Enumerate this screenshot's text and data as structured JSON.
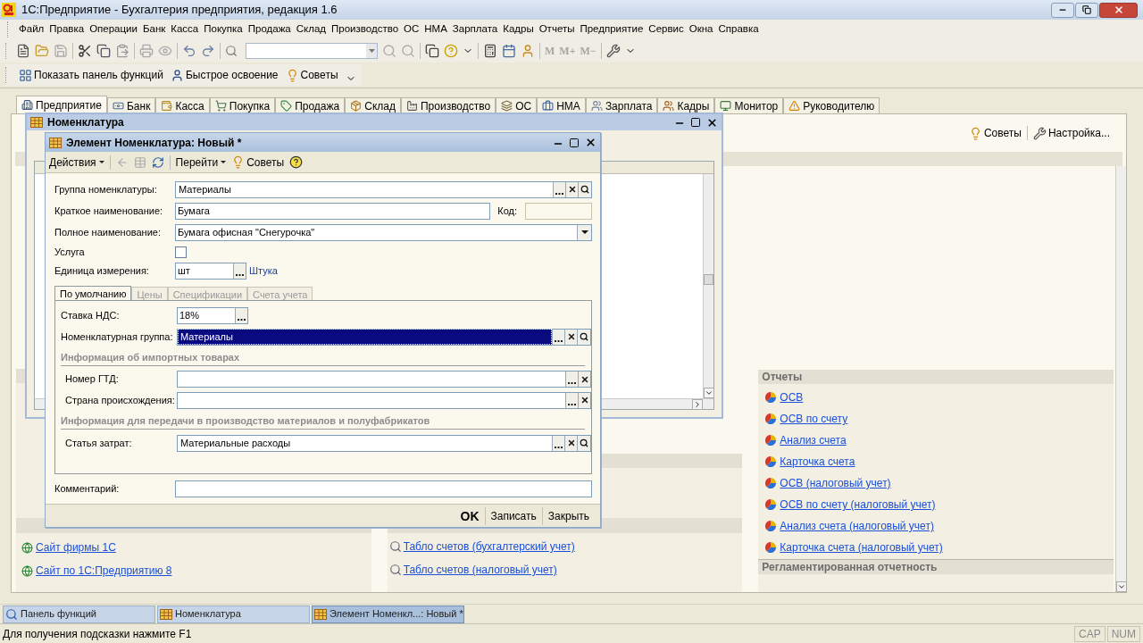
{
  "window": {
    "title": "1С:Предприятие - Бухгалтерия предприятия, редакция 1.6"
  },
  "menu": [
    "Файл",
    "Правка",
    "Операции",
    "Банк",
    "Касса",
    "Покупка",
    "Продажа",
    "Склад",
    "Производство",
    "ОС",
    "НМА",
    "Зарплата",
    "Кадры",
    "Отчеты",
    "Предприятие",
    "Сервис",
    "Окна",
    "Справка"
  ],
  "memory_buttons": [
    "M",
    "M+",
    "M−"
  ],
  "quick_toolbar": [
    "Показать панель функций",
    "Быстрое освоение",
    "Советы"
  ],
  "function_panel": {
    "tabs": [
      {
        "label": "Предприятие",
        "selected": true
      },
      {
        "label": "Банк",
        "selected": false
      },
      {
        "label": "Касса",
        "selected": false
      },
      {
        "label": "Покупка",
        "selected": false
      },
      {
        "label": "Продажа",
        "selected": false
      },
      {
        "label": "Склад",
        "selected": false
      },
      {
        "label": "Производство",
        "selected": false
      },
      {
        "label": "ОС",
        "selected": false
      },
      {
        "label": "НМА",
        "selected": false
      },
      {
        "label": "Зарплата",
        "selected": false
      },
      {
        "label": "Кадры",
        "selected": false
      },
      {
        "label": "Монитор",
        "selected": false
      },
      {
        "label": "Руководителю",
        "selected": false
      }
    ],
    "actions": [
      "Советы",
      "Настройка..."
    ],
    "internet_links": [
      "Сайт фирмы 1С",
      "Сайт по 1С:Предприятию 8"
    ],
    "board_links": [
      "Табло счетов (бухгалтерский учет)",
      "Табло счетов (налоговый учет)"
    ],
    "reports": {
      "title": "Отчеты",
      "links": [
        "ОСВ",
        "ОСВ по счету",
        "Анализ счета",
        "Карточка счета",
        "ОСВ (налоговый учет)",
        "ОСВ по счету (налоговый учет)",
        "Анализ счета (налоговый учет)",
        "Карточка счета (налоговый учет)"
      ]
    },
    "regulated": {
      "title": "Регламентированная отчетность"
    }
  },
  "list_window": {
    "title": "Номенклатура"
  },
  "form": {
    "title": "Элемент Номенклатура: Новый *",
    "toolbar": [
      {
        "label": "Действия",
        "kind": "menu"
      },
      {
        "label": "Перейти",
        "kind": "menu"
      },
      {
        "label": "Советы",
        "kind": "button"
      }
    ],
    "fields": [
      {
        "kind": "reference",
        "label": "Группа номенклатуры:",
        "value": "Материалы",
        "focused": false
      },
      {
        "kind": "text",
        "label": "Краткое наименование:",
        "value": "Бумага",
        "code_label": "Код:",
        "focused": false
      },
      {
        "kind": "dropdown",
        "label": "Полное наименование:",
        "value": "Бумага офисная \"Снегурочка\"",
        "focused": false
      },
      {
        "kind": "checkbox",
        "label": "Услуга",
        "checked": false
      },
      {
        "kind": "unit",
        "label": "Единица измерения:",
        "value": "шт",
        "link": "Штука",
        "focused": false
      }
    ],
    "tabs": [
      {
        "label": "По умолчанию",
        "selected": true
      },
      {
        "label": "Цены",
        "selected": false
      },
      {
        "label": "Спецификации",
        "selected": false
      },
      {
        "label": "Счета учета",
        "selected": false
      }
    ],
    "tab_rows": [
      {
        "kind": "short",
        "label": "Ставка НДС:",
        "value": "18%",
        "focused": false
      },
      {
        "kind": "reference",
        "label": "Номенклатурная группа:",
        "value": "Материалы",
        "focused": true
      },
      {
        "kind": "header",
        "label": "Информация об импортных товарах"
      },
      {
        "kind": "choice",
        "label": "Номер ГТД:",
        "focused": false
      },
      {
        "kind": "choice",
        "label": "Страна происхождения:",
        "focused": false
      },
      {
        "kind": "header",
        "label": "Информация для передачи в производство материалов и полуфабрикатов"
      },
      {
        "kind": "reference",
        "label": "Статья затрат:",
        "value": "Материальные расходы",
        "focused": false
      }
    ],
    "comment": {
      "label": "Комментарий:"
    },
    "buttons": [
      {
        "label": "OK",
        "default": true
      },
      {
        "label": "Записать",
        "default": false
      },
      {
        "label": "Закрыть",
        "default": false
      }
    ]
  },
  "taskbar": [
    {
      "label": "Панель функций",
      "selected": false
    },
    {
      "label": "Номенклатура",
      "selected": false
    },
    {
      "label": "Элемент Номенкл...: Новый *",
      "selected": true
    }
  ],
  "status_bar": {
    "hint": "Для получения подсказки нажмите F1",
    "indicators": [
      "CAP",
      "NUM"
    ]
  }
}
